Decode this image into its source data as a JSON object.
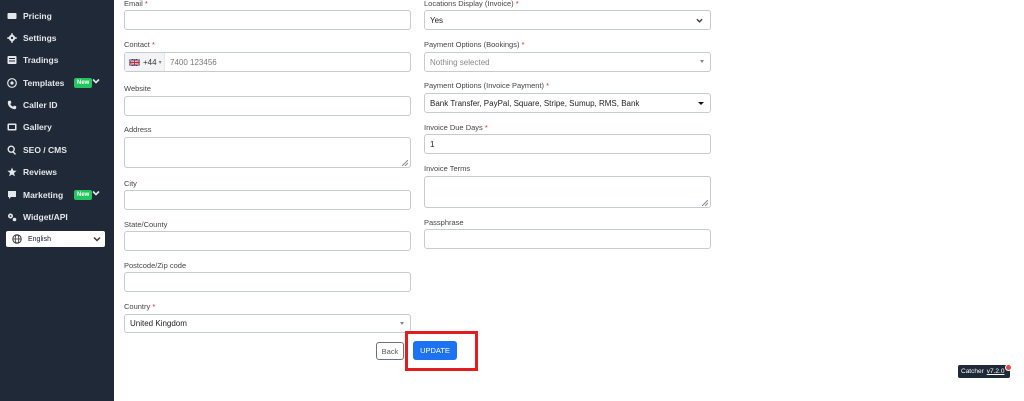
{
  "sidebar": {
    "items": [
      {
        "label": "Pricing",
        "icon": "dollar-icon"
      },
      {
        "label": "Settings",
        "icon": "gear-icon"
      },
      {
        "label": "Tradings",
        "icon": "list-icon"
      },
      {
        "label": "Templates",
        "icon": "at-icon",
        "badge": "New"
      },
      {
        "label": "Caller ID",
        "icon": "phone-icon"
      },
      {
        "label": "Gallery",
        "icon": "image-icon"
      },
      {
        "label": "SEO / CMS",
        "icon": "search-icon"
      },
      {
        "label": "Reviews",
        "icon": "star-icon"
      },
      {
        "label": "Marketing",
        "icon": "comment-icon",
        "badge": "New"
      },
      {
        "label": "Widget/API",
        "icon": "cogs-icon"
      }
    ],
    "language": "English"
  },
  "form": {
    "left": {
      "email_label": "Email",
      "contact_label": "Contact",
      "contact_code": "+44",
      "contact_placeholder": "7400 123456",
      "website_label": "Website",
      "address_label": "Address",
      "city_label": "City",
      "state_label": "State/County",
      "postcode_label": "Postcode/Zip code",
      "country_label": "Country",
      "country_value": "United Kingdom"
    },
    "right": {
      "locations_label": "Locations Display (Invoice)",
      "locations_value": "Yes",
      "payment_bookings_label": "Payment Options (Bookings)",
      "payment_bookings_placeholder": "Nothing selected",
      "payment_invoice_label": "Payment Options (Invoice Payment)",
      "payment_invoice_value": "Bank Transfer, PayPal, Square, Stripe, Sumup, RMS, Bank",
      "due_days_label": "Invoice Due Days",
      "due_days_value": "1",
      "terms_label": "Invoice Terms",
      "passphrase_label": "Passphrase"
    },
    "required_mark": "*"
  },
  "actions": {
    "back": "Back",
    "update": "UPDATE"
  },
  "version_badge": {
    "name": "Catcher",
    "version": "v7.2.0"
  },
  "colors": {
    "sidebar_bg": "#1f2937",
    "accent": "#1d72f2",
    "new_badge": "#22c55e",
    "highlight": "#e11d1d"
  }
}
